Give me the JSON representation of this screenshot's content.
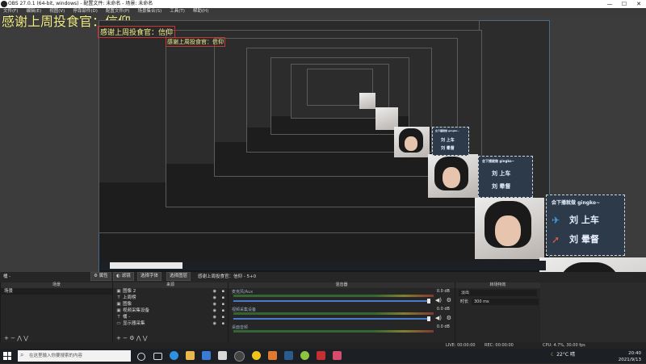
{
  "window": {
    "title": "OBS 27.0.1 (64-bit, windows) - 配置文件: 未命名 - 场景: 未命名",
    "controls": [
      "—",
      "☐",
      "✕"
    ]
  },
  "menu": [
    "文件(F)",
    "编辑(E)",
    "视图(V)",
    "停靠部件(D)",
    "配置文件(P)",
    "场景集合(S)",
    "工具(T)",
    "帮助(H)"
  ],
  "preview": {
    "banner": "感谢上周投食官：",
    "banner_name": "信仰",
    "banner_small": "感谢上周投食官：",
    "banner_small_name": "信仰",
    "sticker": {
      "title": "会下播就做 gingko~",
      "line1": "刘 上车",
      "line2": "刘 晕督"
    }
  },
  "context_bar": {
    "left": "桶 -",
    "properties_button": "属性",
    "filters_button": "滤镜",
    "transition_in": "选择字体",
    "transition_out": "选择图层",
    "scene_text": "感谢上周投食官：信仰 - 5+0"
  },
  "scenes": {
    "header": "场景",
    "items": [
      "场景"
    ]
  },
  "sources": {
    "header": "来源",
    "items": [
      {
        "icon": "image-icon",
        "glyph": "▣",
        "label": "图像 2"
      },
      {
        "icon": "text-icon",
        "glyph": "T",
        "label": "上周榜"
      },
      {
        "icon": "image-icon",
        "glyph": "▣",
        "label": "图像"
      },
      {
        "icon": "camera-icon",
        "glyph": "▣",
        "label": "视频采集设备"
      },
      {
        "icon": "text-icon",
        "glyph": "T",
        "label": "桶 -"
      },
      {
        "icon": "monitor-icon",
        "glyph": "▭",
        "label": "显示器采集"
      }
    ]
  },
  "mixer": {
    "header": "混音器",
    "tracks": [
      {
        "name": "麦克风/Aux",
        "level": "0.0 dB"
      },
      {
        "name": "视频采集设备",
        "level": "0.0 dB"
      },
      {
        "name": "桌面音频",
        "level": "0.0 dB"
      }
    ]
  },
  "transitions": {
    "header": "转场特效",
    "select": "淡出",
    "duration_label": "时长",
    "duration_value": "300 ms"
  },
  "status": {
    "live": "LIVE: 00:00:00",
    "rec": "REC: 00:00:00",
    "cpu": "CPU: 4.7%, 30.00 fps"
  },
  "taskbar": {
    "search_placeholder": "在这里输入你要搜索的内容",
    "temperature": "22°C",
    "weather": "晴",
    "time": "20:40",
    "date": "2021/9/13"
  }
}
